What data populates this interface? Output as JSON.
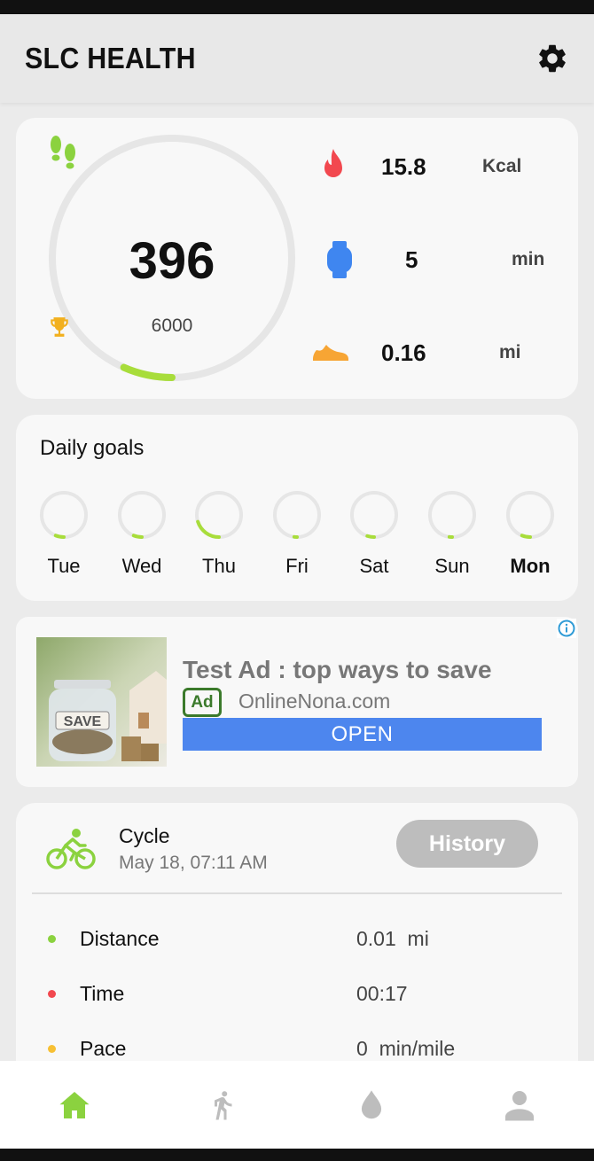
{
  "app": {
    "title": "SLC HEALTH"
  },
  "colors": {
    "accent": "#8bd23f",
    "fire": "#f2484f",
    "watch": "#3f86f0",
    "shoe": "#f7a534"
  },
  "steps": {
    "count": "396",
    "goal": "6000",
    "progress_fraction": 0.066
  },
  "stats": [
    {
      "icon": "fire-icon",
      "value": "15.8",
      "unit": "Kcal"
    },
    {
      "icon": "watch-icon",
      "value": "5",
      "unit": "min"
    },
    {
      "icon": "shoe-icon",
      "value": "0.16",
      "unit": "mi"
    }
  ],
  "daily_goals": {
    "title": "Daily goals",
    "days": [
      {
        "label": "Tue",
        "progress": 0.06,
        "bold": false
      },
      {
        "label": "Wed",
        "progress": 0.06,
        "bold": false
      },
      {
        "label": "Thu",
        "progress": 0.2,
        "bold": false
      },
      {
        "label": "Fri",
        "progress": 0.02,
        "bold": false
      },
      {
        "label": "Sat",
        "progress": 0.05,
        "bold": false
      },
      {
        "label": "Sun",
        "progress": 0.02,
        "bold": false
      },
      {
        "label": "Mon",
        "progress": 0.06,
        "bold": true
      }
    ]
  },
  "ad": {
    "title": "Test Ad : top ways to save",
    "badge": "Ad",
    "domain": "OnlineNona.com",
    "cta": "OPEN",
    "jar_label": "SAVE"
  },
  "activity": {
    "name": "Cycle",
    "date": "May 18, 07:11 AM",
    "history_label": "History",
    "metrics": [
      {
        "label": "Distance",
        "value": "0.01  mi",
        "color": "#8bd23f"
      },
      {
        "label": "Time",
        "value": "00:17",
        "color": "#f2484f"
      },
      {
        "label": "Pace",
        "value": "0  min/mile",
        "color": "#f7c034"
      }
    ]
  },
  "nav": [
    {
      "icon": "home-icon",
      "active": true
    },
    {
      "icon": "run-icon",
      "active": false
    },
    {
      "icon": "drop-icon",
      "active": false
    },
    {
      "icon": "user-icon",
      "active": false
    }
  ]
}
